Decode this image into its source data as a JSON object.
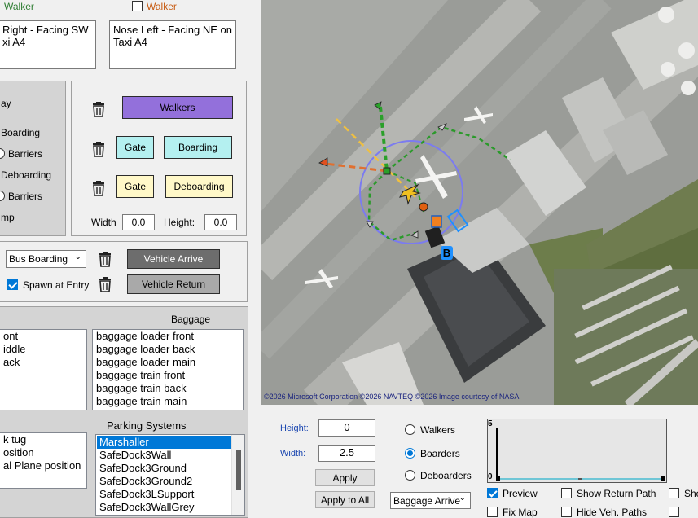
{
  "top": {
    "walker_left_label": "Walker",
    "walker_right_label": "Walker",
    "walker_right_checked": false,
    "text_left": "Right - Facing SW\nxi A4",
    "text_right": "Nose Left - Facing NE on Taxi A4"
  },
  "passenger_panel": {
    "partial_labels": [
      "ay",
      "Boarding",
      "Barriers",
      "Deboarding",
      "Barriers",
      "mp"
    ]
  },
  "gate_panel": {
    "walkers_label": "Walkers",
    "gate_label_1": "Gate",
    "boarding_label": "Boarding",
    "gate_label_2": "Gate",
    "deboarding_label": "Deboarding",
    "width_label": "Width",
    "width_value": "0.0",
    "height_label": "Height:",
    "height_value": "0.0"
  },
  "vehicle_panel": {
    "select_value": "Bus Boarding",
    "arrive_label": "Vehicle Arrive",
    "spawn_label": "Spawn at Entry",
    "spawn_checked": true,
    "return_label": "Vehicle Return"
  },
  "baggage": {
    "title": "Baggage",
    "left_list": [
      "ont",
      "iddle",
      "ack"
    ],
    "right_list": [
      "baggage loader front",
      "baggage loader back",
      "baggage loader main",
      "baggage train front",
      "baggage train back",
      "baggage train main"
    ]
  },
  "parking": {
    "title": "Parking Systems",
    "left_list": [
      "k tug",
      "osition",
      "al Plane position"
    ],
    "items": [
      "Marshaller",
      "SafeDock3Wall",
      "SafeDock3Ground",
      "SafeDock3Ground2",
      "SafeDock3LSupport",
      "SafeDock3WallGrey"
    ],
    "selected": "Marshaller"
  },
  "map": {
    "attribution": "©2026 Microsoft Corporation ©2026 NAVTEQ ©2026 Image courtesy of NASA",
    "marker_label": "B"
  },
  "bottom": {
    "height_label": "Height:",
    "height_value": "0",
    "width_label": "Width:",
    "width_value": "2.5",
    "apply_label": "Apply",
    "apply_all_label": "Apply to All",
    "radio_walkers": "Walkers",
    "radio_boarders": "Boarders",
    "radio_deboarders": "Deboarders",
    "selected_radio": "Boarders",
    "select_value": "Baggage Arrive",
    "graph_ymax": "5",
    "graph_ymin": "0",
    "preview_label": "Preview",
    "preview_checked": true,
    "show_return_path_label": "Show Return Path",
    "sho_label": "Sho",
    "fix_map_label": "Fix Map",
    "hide_veh_paths_label": "Hide Veh. Paths"
  }
}
